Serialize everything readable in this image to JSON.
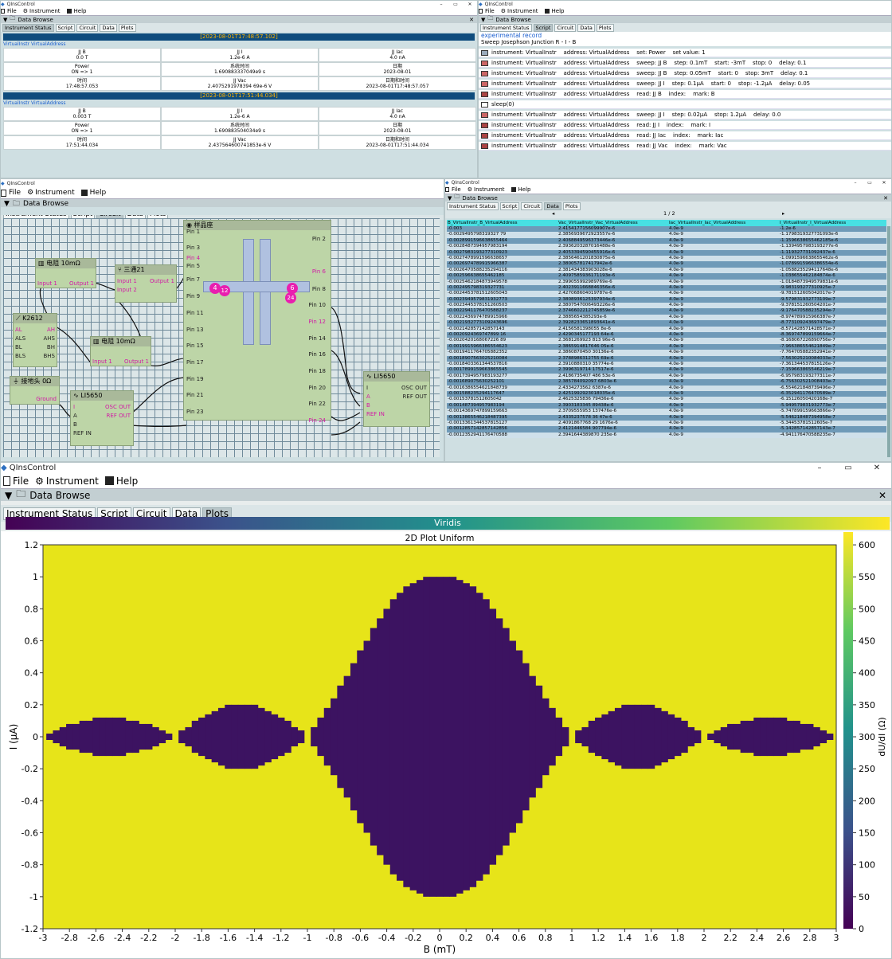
{
  "app_title": "QInsControl",
  "menu": {
    "file": "File",
    "instrument": "Instrument",
    "help": "Help"
  },
  "data_browse": "Data Browse",
  "tabs": [
    "Instrument Status",
    "Script",
    "Circuit",
    "Data",
    "Plots"
  ],
  "status_window": {
    "sections": [
      {
        "header": "[2023-08-01T17:48:57.102]",
        "instr": "VirtualInstr",
        "addr": "VirtualAddress",
        "cells": [
          [
            "JJ B",
            "0.0 T"
          ],
          [
            "JJ I",
            "1.2e-6 A"
          ],
          [
            "JJ Iac",
            "4.0 nA"
          ],
          [
            "Power",
            "ON => 1"
          ],
          [
            "系统时间",
            "1.690883337049e9 s"
          ],
          [
            "日期",
            "2023-08-01"
          ],
          [
            "时间",
            "17:48:57.053"
          ],
          [
            "JJ Vac",
            "2.4075291978394 69e-6 V"
          ],
          [
            "日期和时间",
            "2023-08-01T17:48:57.057"
          ]
        ]
      },
      {
        "header": "[2023-08-01T17:51:44.034]",
        "instr": "VirtualInstr",
        "addr": "VirtualAddress",
        "cells": [
          [
            "JJ B",
            "0.003 T"
          ],
          [
            "JJ I",
            "1.2e-6 A"
          ],
          [
            "JJ Iac",
            "4.0 nA"
          ],
          [
            "Power",
            "ON => 1"
          ],
          [
            "系统时间",
            "1.690883504034e9 s"
          ],
          [
            "日期",
            "2023-08-01"
          ],
          [
            "时间",
            "17:51:44.034"
          ],
          [
            "JJ Vac",
            "2.437564600741853e-6 V"
          ],
          [
            "日期和时间",
            "2023-08-01T17:51:44.034"
          ]
        ]
      }
    ]
  },
  "script_window": {
    "record_title": "experimental record",
    "record_desc": "Sweep Josephson Junction R - I - B",
    "rows": [
      "instrument: VirtualInstr    address: VirtualAddress    set: Power    set value: 1",
      "instrument: VirtualInstr    address: VirtualAddress    sweep: JJ B    step: 0.1mT    start: -3mT    stop: 0    delay: 0.1",
      "instrument: VirtualInstr    address: VirtualAddress    sweep: JJ B    step: 0.05mT    start: 0    stop: 3mT    delay: 0.1",
      "instrument: VirtualInstr    address: VirtualAddress    sweep: JJ I    step: 0.1μA    start: 0    stop: -1.2μA    delay: 0.05",
      "instrument: VirtualInstr    address: VirtualAddress    read: JJ B    index:    mark: B",
      "sleep(0)",
      "instrument: VirtualInstr    address: VirtualAddress    sweep: JJ I    step: 0.02μA    stop: 1.2μA    delay: 0.0",
      "instrument: VirtualInstr    address: VirtualAddress    read: JJ I    index:    mark: I",
      "instrument: VirtualInstr    address: VirtualAddress    read: JJ Iac    index:    mark: Iac",
      "instrument: VirtualInstr    address: VirtualAddress    read: JJ Vac    index:    mark: Vac"
    ]
  },
  "circuit": {
    "sample_holder": "样品座",
    "left_pins": [
      "Pin 1",
      "Pin 3",
      "Pin 4",
      "Pin 5",
      "Pin 7",
      "Pin 9",
      "Pin 11",
      "Pin 13",
      "Pin 15",
      "Pin 17",
      "Pin 19",
      "Pin 21",
      "Pin 23"
    ],
    "right_pins": [
      "Pin 2",
      "Pin 6",
      "Pin 8",
      "Pin 10",
      "Pin 12",
      "Pin 14",
      "Pin 16",
      "Pin 18",
      "Pin 20",
      "Pin 22",
      "Pin 24"
    ],
    "markers": [
      "4",
      "12",
      "6",
      "24"
    ],
    "res1": {
      "title": "电阻 10mΩ",
      "in": "Input 1",
      "out": "Output 1"
    },
    "tee": {
      "title": "三通21",
      "in1": "Input 1",
      "in2": "Input 2",
      "out": "Output 1"
    },
    "k2612": {
      "title": "K2612",
      "ports": [
        "AL",
        "AH",
        "ALS",
        "AHS",
        "BL",
        "BH",
        "BLS",
        "BHS"
      ]
    },
    "res2": {
      "title": "电阻 10mΩ",
      "in": "Input 1",
      "out": "Output 1"
    },
    "ground": {
      "title": "接地头 0Ω",
      "port": "Ground"
    },
    "li1": {
      "title": "LI5650",
      "ports": [
        "I",
        "A",
        "B",
        "REF IN",
        "OSC OUT",
        "REF OUT"
      ]
    },
    "li2": {
      "title": "LI5650",
      "ports": [
        "I",
        "A",
        "B",
        "REF IN",
        "OSC OUT",
        "REF OUT"
      ]
    }
  },
  "data_window": {
    "page": "1 / 2",
    "columns": [
      "B_VirtualInstr_B_VirtualAddress",
      "Vac_VirtualInstr_Vac_VirtualAddress",
      "Iac_VirtualInstr_Iac_VirtualAddress",
      "I_VirtualInstr_I_VirtualAddress"
    ],
    "rows": [
      [
        "-0.003",
        "2.4154177156099907e-6",
        "4.0e-9",
        "-1.2e-6"
      ],
      [
        "-0.0029495798319327 79",
        "2.3856939672923557e-6",
        "4.0e-9",
        "-1.1798319327731093e-6"
      ],
      [
        "-0.0028991596638655464",
        "2.4068849596373446e-6",
        "4.0e-9",
        "-1.1596638655462185e-6"
      ],
      [
        "-0.0028487394957983194",
        "2.3936203287016488e-6",
        "4.0e-9",
        "-1.1394957983193277e-6"
      ],
      [
        "-0.0027983193277310923",
        "2.4053394590455916e-6",
        "4.0e-9",
        "-1.119327731092437e-6"
      ],
      [
        "-0.0027478991596638657",
        "2.3856461201830875e-6",
        "4.0e-9",
        "-1.0991596638655462e-6"
      ],
      [
        "-0.0026974789915966387",
        "2.380057817417942e-6",
        "4.0e-9",
        "-1.0789915966386554e-6"
      ],
      [
        "-0.0026470588235294116",
        "2.381434383903028e-6",
        "4.0e-9",
        "-1.0588235294117648e-6"
      ],
      [
        "-0.002596638655462185",
        "2.4097585936171193e-6",
        "4.0e-9",
        "-1.038655462184874e-6"
      ],
      [
        "-0.0025462184873949578",
        "2.399055992989769e-6",
        "4.0e-9",
        "-1.0184873949579831e-6"
      ],
      [
        "-0.002495798319327731",
        "2.4023911668846356e-6",
        "4.0e-9",
        "-9.983193277310925e-7"
      ],
      [
        "-0.0024453781512605043",
        "2.427068604019787e-6",
        "4.0e-9",
        "-9.781512605042017e-7"
      ],
      [
        "-0.0023949579831932773",
        "2.3808936125397934e-6",
        "4.0e-9",
        "-9.579831932773109e-7"
      ],
      [
        "-0.0023445378151260503",
        "2.3807547006493226e-6",
        "4.0e-9",
        "-9.378151260504201e-7"
      ],
      [
        "-0.0022941176470588237",
        "2.3746602212745859e-6",
        "4.0e-9",
        "-9.176470588235294e-7"
      ],
      [
        "-0.0022436974789915966",
        "2.3885654385293e-6",
        "4.0e-9",
        "-8.974789915966387e-7"
      ],
      [
        "-0.0021932773109243696",
        "2.3928233651893641e-6",
        "4.0e-9",
        "-8.773109243697479e-7"
      ],
      [
        "-0.002142857142857143",
        "2.4156581398055 8e-6",
        "4.0e-9",
        "-8.571428571428571e-7"
      ],
      [
        "-0.0020924369747899 16",
        "2.4290345177193 64e-6",
        "4.0e-9",
        "-8.369747899159664e-7"
      ],
      [
        "-0.0020420168067226 89",
        "2.3681269923 813 96e-6",
        "4.0e-9",
        "-8.168067226890756e-7"
      ],
      [
        "-0.0019915966386554623",
        "2.3865914817646 05e-6",
        "4.0e-9",
        "-7.966386554621849e-7"
      ],
      [
        "-0.0019411764705882352",
        "2.3860870450 30136e-6",
        "4.0e-9",
        "-7.764705882352941e-7"
      ],
      [
        "-0.0018907563025210084",
        "2.3788986312755 69e-6",
        "4.0e-9",
        "-7.563025210084033e-7"
      ],
      [
        "-0.0018403361344537816",
        "2.3910880310 35774e-6",
        "4.0e-9",
        "-7.361344537815126e-7"
      ],
      [
        "-0.0017899159663865545",
        "2.3996319714 17517e-6",
        "4.0e-9",
        "-7.159663865546219e-7"
      ],
      [
        "-0.0017394957983193277",
        "2.4186735407 486 53e-6",
        "4.0e-9",
        "-6.957983193277311e-7"
      ],
      [
        "-0.001689075630252101",
        "2.385784092097 6803e-6",
        "4.0e-9",
        "-6.756302521008403e-7"
      ],
      [
        "-0.0016386554621848739",
        "2.4334273562 6387e-6",
        "4.0e-9",
        "-6.554621848739496e-7"
      ],
      [
        "-0.001588235294117647",
        "2.4251992923018035e-6",
        "4.0e-9",
        "-6.352941176470589e-7"
      ],
      [
        "-0.00153781512605042",
        "2.4625325836 79436e-6",
        "4.0e-9",
        "-6.15126050420168e-7"
      ],
      [
        "-0.001487394957983194",
        "2.3903183345 89438e-6",
        "4.0e-9",
        "-5.949579831932773e-7"
      ],
      [
        "-0.0014369747899159663",
        "2.3709555953 137476e-6",
        "4.0e-9",
        "-5.747899159663866e-7"
      ],
      [
        "-0.0013865546218487395",
        "2.4335237578 36 47e-6",
        "4.0e-9",
        "-5.546218487394958e-7"
      ],
      [
        "-0.0013361344537815127",
        "2.4091867768 29 1676e-6",
        "4.0e-9",
        "-5.34453781512605e-7"
      ],
      [
        "-0.0012857142857142856",
        "2.4121446584 907794e-6",
        "4.0e-9",
        "-5.142857142857143e-7"
      ],
      [
        "-0.0012352941176470588",
        "2.3941644389870 235e-6",
        "4.0e-9",
        "-4.941176470588235e-7"
      ]
    ]
  },
  "plot_window": {
    "colormap": "Viridis",
    "colors": {
      "low": "#3c1361",
      "high": "#e7e419"
    }
  },
  "chart_data": {
    "type": "heatmap",
    "title": "2D Plot Uniform",
    "xlabel": "B (mT)",
    "ylabel": "I (μA)",
    "colorbar_label": "dU/dI (Ω)",
    "xlim": [
      -3,
      3
    ],
    "ylim": [
      -1.2,
      1.2
    ],
    "zlim": [
      0,
      620
    ],
    "x_ticks": [
      "-3",
      "-2.8",
      "-2.6",
      "-2.4",
      "-2.2",
      "-2",
      "-1.8",
      "-1.6",
      "-1.4",
      "-1.2",
      "-1",
      "-0.8",
      "-0.6",
      "-0.4",
      "-0.2",
      "0",
      "0.2",
      "0.4",
      "0.6",
      "0.8",
      "1",
      "1.2",
      "1.4",
      "1.6",
      "1.8",
      "2",
      "2.2",
      "2.4",
      "2.6",
      "2.8",
      "3"
    ],
    "y_ticks": [
      "1.2",
      "1",
      "0.8",
      "0.6",
      "0.4",
      "0.2",
      "0",
      "-0.2",
      "-0.4",
      "-0.6",
      "-0.8",
      "-1",
      "-1.2"
    ],
    "colorbar_ticks": [
      "600",
      "550",
      "500",
      "450",
      "400",
      "350",
      "300",
      "250",
      "200",
      "150",
      "100",
      "50",
      "0"
    ],
    "x_step": 0.05,
    "y_step": 0.02,
    "low_value": 10,
    "high_value": 600,
    "critical_current_lobes": [
      {
        "b_center": 0,
        "half_width": 1,
        "ic_peak": 1.0
      },
      {
        "b_center": -1.5,
        "half_width": 0.5,
        "ic_peak": 0.2
      },
      {
        "b_center": 1.5,
        "half_width": 0.5,
        "ic_peak": 0.2
      },
      {
        "b_center": -2.5,
        "half_width": 0.5,
        "ic_peak": 0.12
      },
      {
        "b_center": 2.5,
        "half_width": 0.5,
        "ic_peak": 0.12
      }
    ]
  }
}
